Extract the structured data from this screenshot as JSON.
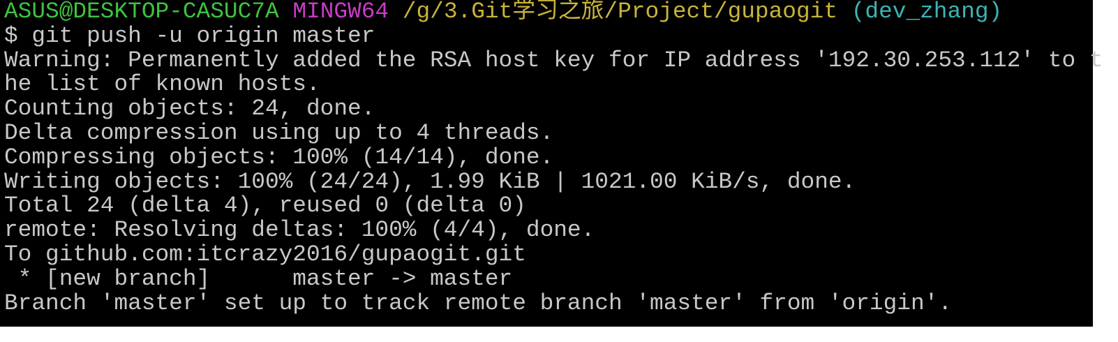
{
  "prompt": {
    "user_host": "ASUS@DESKTOP-CASUC7A",
    "system": "MINGW64",
    "path": "/g/3.Git学习之旅/Project/gupaogit",
    "branch": "(dev_zhang)"
  },
  "command": "$ git push -u origin master",
  "output": [
    "Warning: Permanently added the RSA host key for IP address '192.30.253.112' to t",
    "he list of known hosts.",
    "Counting objects: 24, done.",
    "Delta compression using up to 4 threads.",
    "Compressing objects: 100% (14/14), done.",
    "Writing objects: 100% (24/24), 1.99 KiB | 1021.00 KiB/s, done.",
    "Total 24 (delta 4), reused 0 (delta 0)",
    "remote: Resolving deltas: 100% (4/4), done.",
    "To github.com:itcrazy2016/gupaogit.git",
    " * [new branch]      master -> master",
    "Branch 'master' set up to track remote branch 'master' from 'origin'."
  ],
  "colors": {
    "user_host": "#3ec43e",
    "system": "#c83cc8",
    "path": "#c8b43c",
    "branch": "#3cb4b4",
    "text": "#c8c8c8",
    "background": "#000000"
  }
}
